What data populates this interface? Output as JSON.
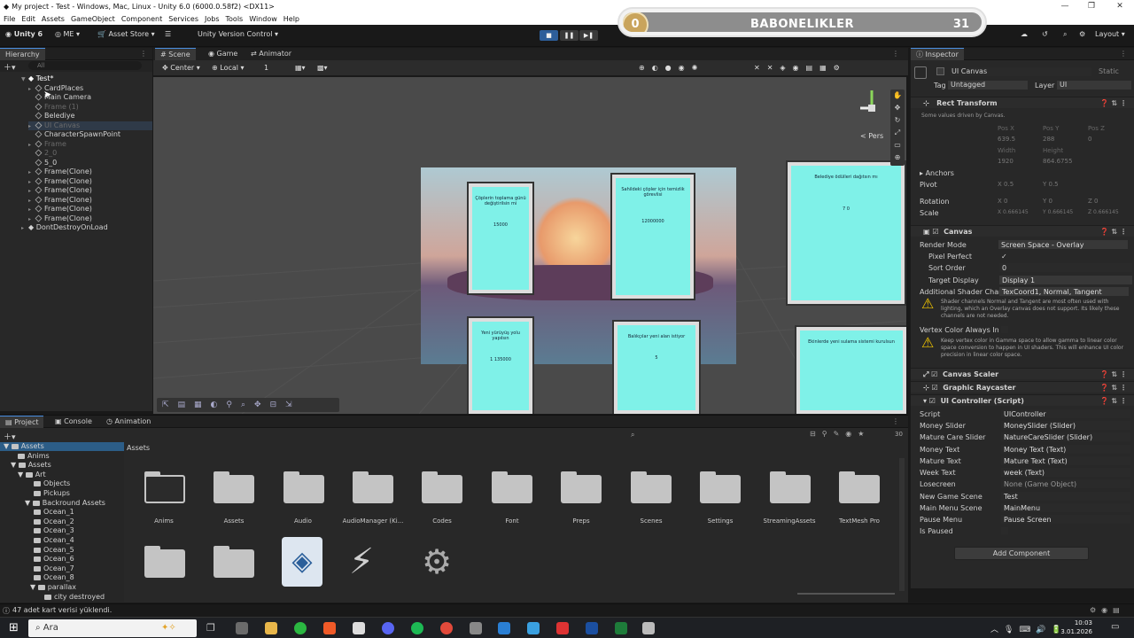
{
  "window": {
    "title": "My project - Test - Windows, Mac, Linux - Unity 6.0 (6000.0.58f2) <DX11>",
    "controls": [
      "—",
      "❐",
      "✕"
    ]
  },
  "menubar": [
    "File",
    "Edit",
    "Assets",
    "GameObject",
    "Component",
    "Services",
    "Jobs",
    "Tools",
    "Window",
    "Help"
  ],
  "toolbar": {
    "unity": "Unity 6",
    "account": "ME",
    "asset_store": "Asset Store",
    "version_control": "Unity Version Control",
    "layout": "Layout"
  },
  "hud": {
    "coin": "0",
    "title": "BABONELIKLER",
    "count": "31",
    "progress": 0.07
  },
  "hierarchy": {
    "tab": "Hierarchy",
    "search_placeholder": "All",
    "scene": "Test*",
    "items": [
      "CardPlaces",
      "Main Camera",
      "Frame (1)",
      "Belediye",
      "UI Canvas",
      "CharacterSpawnPoint",
      "Frame",
      "2_0",
      "5_0",
      "Frame(Clone)",
      "Frame(Clone)",
      "Frame(Clone)",
      "Frame(Clone)",
      "Frame(Clone)",
      "Frame(Clone)"
    ],
    "dont_destroy": "DontDestroyOnLoad"
  },
  "scene_tabs": {
    "scene": "Scene",
    "game": "Game",
    "animator": "Animator"
  },
  "scene_toolbar": {
    "pivot": "Center",
    "space": "Local",
    "grid": "1"
  },
  "scene_overlay": {
    "persp": "< Pers"
  },
  "cards": [
    {
      "text": "Çöplerin toplama günü değiştirilsin mi",
      "num": "15000"
    },
    {
      "text": "Sahildeki çöpler için temizlik görevlisi",
      "num": "12000000"
    },
    {
      "text": "Belediye ödülleri dağıtsın mı",
      "num": "7 0"
    },
    {
      "text": "Yeni yürüyüş yolu yapılsın",
      "num": "1 135000"
    },
    {
      "text": "Balıkçılar yeni alan istiyor",
      "num": "5"
    },
    {
      "text": "Ekinlerde yeni sulama sistemi kurulsun",
      "num": ""
    }
  ],
  "inspector": {
    "tab": "Inspector",
    "object_name": "UI Canvas",
    "static": "Static",
    "tag_label": "Tag",
    "tag": "Untagged",
    "layer_label": "Layer",
    "layer": "UI",
    "rect_transform": "Rect Transform",
    "driven_note": "Some values driven by Canvas.",
    "pos_labels": [
      "Pos X",
      "Pos Y",
      "Pos Z"
    ],
    "pos_values": [
      "639.5",
      "288",
      "0"
    ],
    "size_labels": [
      "Width",
      "Height"
    ],
    "size_values": [
      "1920",
      "864.6755"
    ],
    "anchors": "Anchors",
    "pivot": "Pivot",
    "pivot_x": "X 0.5",
    "pivot_y": "Y 0.5",
    "rotation": "Rotation",
    "rot_vals": [
      "X 0",
      "Y 0",
      "Z 0"
    ],
    "scale": "Scale",
    "scale_vals": [
      "X 0.666145",
      "Y 0.666145",
      "Z 0.666145"
    ],
    "canvas": "Canvas",
    "render_mode_label": "Render Mode",
    "render_mode": "Screen Space - Overlay",
    "pixel_perfect": "Pixel Perfect",
    "sort_order_label": "Sort Order",
    "sort_order": "0",
    "target_display_label": "Target Display",
    "target_display": "Display 1",
    "shader_label": "Additional Shader Char",
    "shader": "TexCoord1, Normal, Tangent",
    "warn1": "Shader channels Normal and Tangent are most often used with lighting, which an Overlay canvas does not support. Its likely these channels are not needed.",
    "vertex_color": "Vertex Color Always In",
    "warn2": "Keep vertex color in Gamma space to allow gamma to linear color space conversion to happen in UI shaders. This will enhance UI color precision in linear color space.",
    "canvas_scaler": "Canvas Scaler",
    "raycaster": "Graphic Raycaster",
    "ui_controller": "UI Controller (Script)",
    "fields": [
      {
        "k": "Script",
        "v": "UIController"
      },
      {
        "k": "Money Slider",
        "v": "MoneySlider (Slider)"
      },
      {
        "k": "Mature Care Slider",
        "v": "NatureCareSlider (Slider)"
      },
      {
        "k": "Money Text",
        "v": "Money Text (Text)"
      },
      {
        "k": "Mature Text",
        "v": "Mature Text (Text)"
      },
      {
        "k": "Week Text",
        "v": "week (Text)"
      },
      {
        "k": "Losecreen",
        "v": "None (Game Object)"
      },
      {
        "k": "New Game Scene",
        "v": "Test"
      },
      {
        "k": "Main Menu Scene",
        "v": "MainMenu"
      },
      {
        "k": "Pause Menu",
        "v": "Pause Screen"
      },
      {
        "k": "Is Paused",
        "v": ""
      }
    ],
    "add_component": "Add Component"
  },
  "project": {
    "tabs": [
      "Project",
      "Console",
      "Animation"
    ],
    "tree": [
      "Assets",
      "Anims",
      "Assets",
      "Art",
      "Objects",
      "Pickups",
      "Backround Assets",
      "Ocean_1",
      "Ocean_2",
      "Ocean_3",
      "Ocean_4",
      "Ocean_5",
      "Ocean_6",
      "Ocean_7",
      "Ocean_8",
      "parallax",
      "city destroyed"
    ],
    "breadcrumb": "Assets",
    "count": "30",
    "folders": [
      "Anims",
      "Assets",
      "Audio",
      "AudioManager (Ki...",
      "Codes",
      "Font",
      "Preps",
      "Scenes",
      "Settings",
      "StreamingAssets",
      "TextMesh Pro"
    ]
  },
  "status": "47 adet kart verisi yüklendi.",
  "taskbar": {
    "search": "Ara",
    "time": "10:03",
    "date": "3.01.2026"
  }
}
